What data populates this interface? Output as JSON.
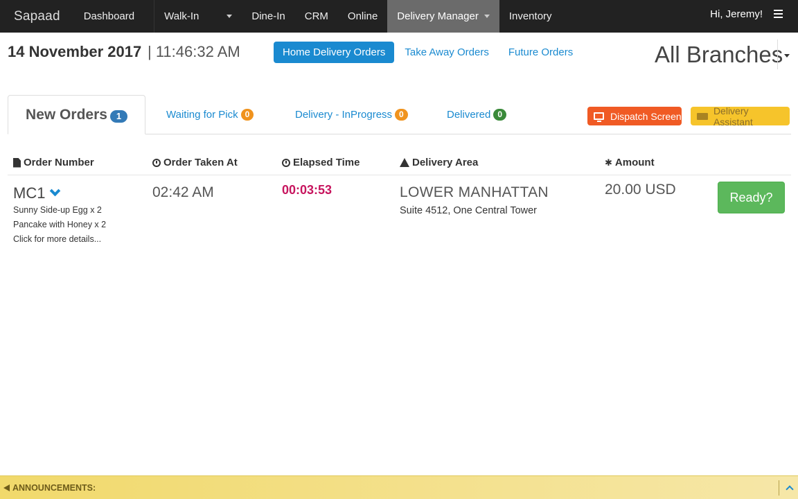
{
  "nav": {
    "brand": "Sapaad",
    "items": [
      "Dashboard",
      "Walk-In",
      "Dine-In",
      "CRM",
      "Online",
      "Delivery Manager",
      "Inventory"
    ],
    "greeting": "Hi, Jeremy!"
  },
  "header": {
    "date": "14 November 2017",
    "time": "| 11:46:32 AM",
    "order_types": [
      "Home Delivery Orders",
      "Take Away Orders",
      "Future Orders"
    ],
    "branch": "All Branches"
  },
  "status_tabs": {
    "new_orders": {
      "label": "New Orders",
      "count": "1"
    },
    "waiting": {
      "label": "Waiting for Pick",
      "count": "0"
    },
    "in_progress": {
      "label": "Delivery - InProgress",
      "count": "0"
    },
    "delivered": {
      "label": "Delivered",
      "count": "0"
    },
    "dispatch": "Dispatch Screen",
    "assistant": "Delivery Assistant"
  },
  "table": {
    "columns": [
      "Order Number",
      "Order Taken At",
      "Elapsed Time",
      "Delivery Area",
      "Amount"
    ],
    "rows": [
      {
        "order_number": "MC1",
        "items": [
          "Sunny Side-up Egg x 2",
          "Pancake with Honey x 2",
          "Click for more details..."
        ],
        "taken_at": "02:42 AM",
        "elapsed": "00:03:53",
        "area": "LOWER MANHATTAN",
        "address": "Suite 4512, One Central Tower",
        "amount": "20.00 USD",
        "action": "Ready?"
      }
    ]
  },
  "announcements": {
    "label": "ANNOUNCEMENTS:"
  },
  "colors": {
    "accent": "#1a8ad0",
    "dispatch": "#f05a24",
    "assistant": "#f6c42b",
    "ready": "#5cb85c",
    "elapsed": "#c7155e"
  }
}
